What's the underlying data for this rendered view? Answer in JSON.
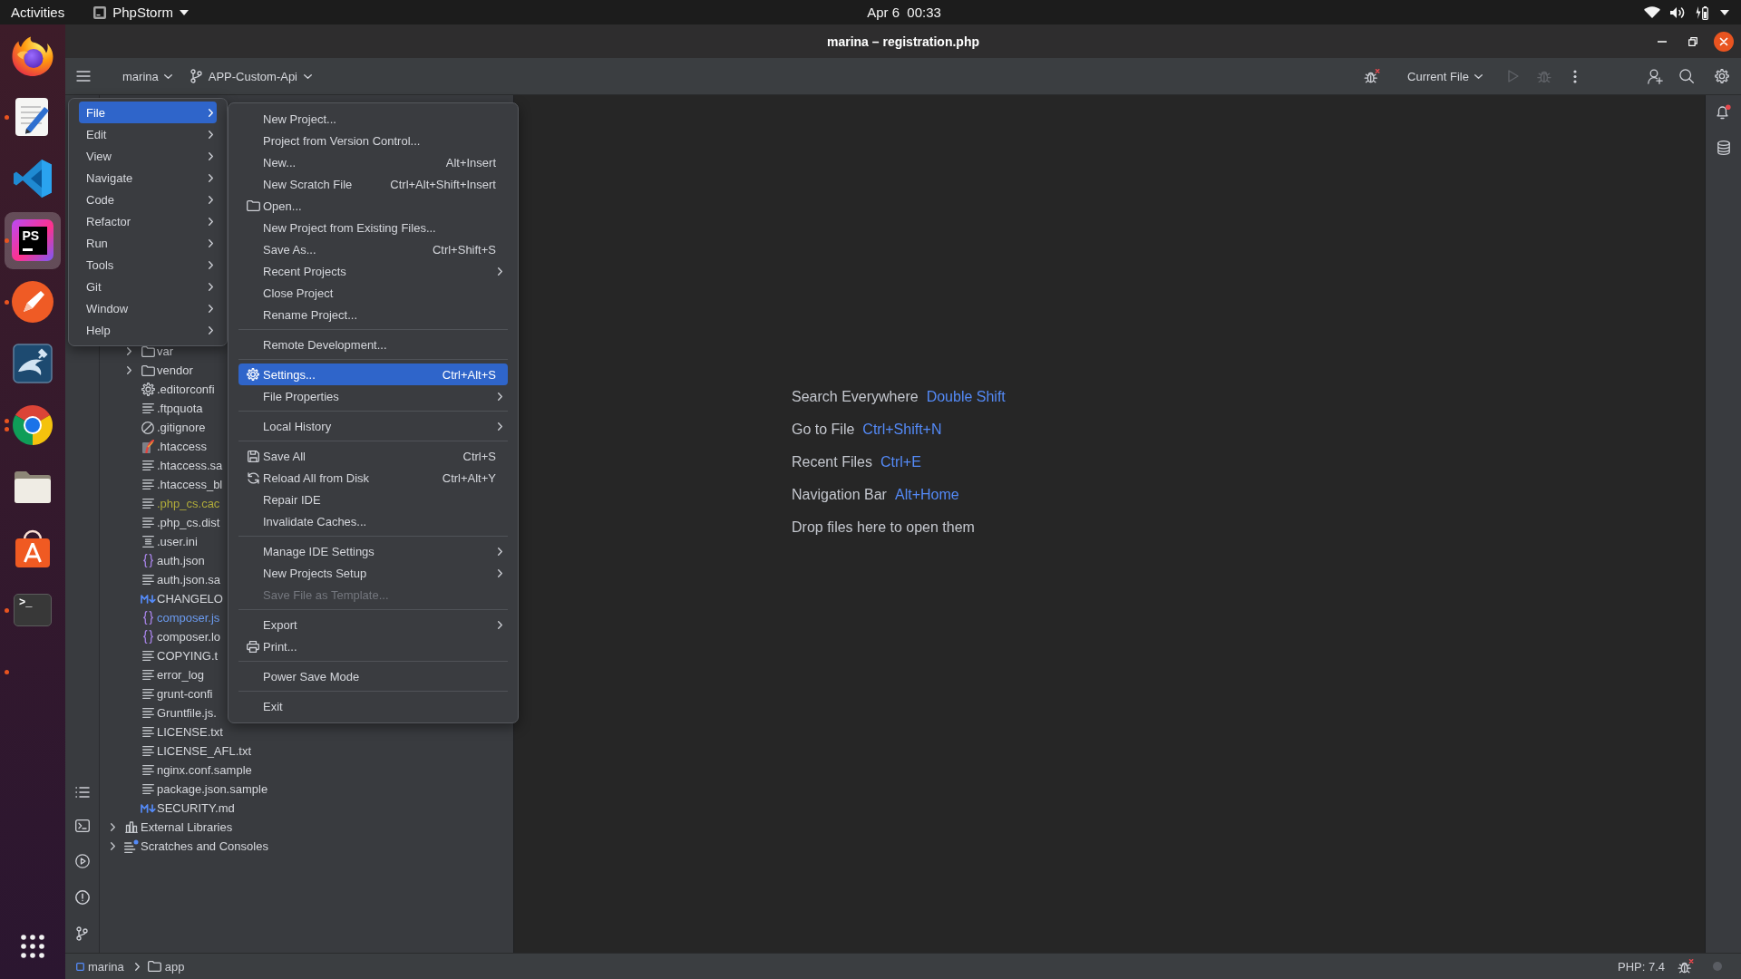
{
  "top_bar": {
    "activities": "Activities",
    "app_name": "PhpStorm",
    "clock": "Apr 6  00:33"
  },
  "dock": {
    "items": [
      {
        "kind": "fox-browser",
        "running": false,
        "multiple_windows": false,
        "selected": false
      },
      {
        "kind": "text-editor",
        "running": true,
        "multiple_windows": false,
        "selected": false
      },
      {
        "kind": "code-editor",
        "running": false,
        "multiple_windows": false,
        "selected": false
      },
      {
        "kind": "ide",
        "logo_text": "PS",
        "running": true,
        "multiple_windows": false,
        "selected": true
      },
      {
        "kind": "pen-circle",
        "running": true,
        "multiple_windows": false,
        "selected": false
      },
      {
        "kind": "dolphin",
        "running": false,
        "multiple_windows": false,
        "selected": false
      },
      {
        "kind": "wheel-browser",
        "running": true,
        "multiple_windows": true,
        "selected": false
      },
      {
        "kind": "files",
        "running": false,
        "multiple_windows": false,
        "selected": false
      },
      {
        "kind": "store-bag",
        "running": false,
        "multiple_windows": false,
        "selected": false
      },
      {
        "kind": "terminal",
        "logo_text": ">_",
        "running": true,
        "multiple_windows": false,
        "selected": false
      },
      {
        "kind": "none",
        "running": true,
        "multiple_windows": false,
        "selected": false
      }
    ]
  },
  "title_bar": {
    "title": "marina – registration.php"
  },
  "toolbar": {
    "project": "marina",
    "branch": "APP-Custom-Api",
    "run_configuration": "Current File"
  },
  "main_menu": {
    "items": [
      {
        "label": "File",
        "submenu": true,
        "selected": true
      },
      {
        "label": "Edit",
        "submenu": true,
        "selected": false
      },
      {
        "label": "View",
        "submenu": true,
        "selected": false
      },
      {
        "label": "Navigate",
        "submenu": true,
        "selected": false
      },
      {
        "label": "Code",
        "submenu": true,
        "selected": false
      },
      {
        "label": "Refactor",
        "submenu": true,
        "selected": false
      },
      {
        "label": "Run",
        "submenu": true,
        "selected": false
      },
      {
        "label": "Tools",
        "submenu": true,
        "selected": false
      },
      {
        "label": "Git",
        "submenu": true,
        "selected": false
      },
      {
        "label": "Window",
        "submenu": true,
        "selected": false
      },
      {
        "label": "Help",
        "submenu": true,
        "selected": false
      }
    ]
  },
  "file_menu": {
    "groups": [
      [
        {
          "label": "New Project...",
          "kind": "plain",
          "submenu": false,
          "disabled": false,
          "selected": false
        },
        {
          "label": "Project from Version Control...",
          "kind": "plain",
          "submenu": false,
          "disabled": false,
          "selected": false
        },
        {
          "label": "New...",
          "kind": "plain",
          "shortcut": "Alt+Insert",
          "submenu": false,
          "disabled": false,
          "selected": false
        },
        {
          "label": "New Scratch File",
          "kind": "plain",
          "shortcut": "Ctrl+Alt+Shift+Insert",
          "submenu": false,
          "disabled": false,
          "selected": false
        },
        {
          "label": "Open...",
          "kind": "open",
          "submenu": false,
          "disabled": false,
          "selected": false
        },
        {
          "label": "New Project from Existing Files...",
          "kind": "plain",
          "submenu": false,
          "disabled": false,
          "selected": false
        },
        {
          "label": "Save As...",
          "kind": "plain",
          "shortcut": "Ctrl+Shift+S",
          "submenu": false,
          "disabled": false,
          "selected": false
        },
        {
          "label": "Recent Projects",
          "kind": "plain",
          "submenu": true,
          "disabled": false,
          "selected": false
        },
        {
          "label": "Close Project",
          "kind": "plain",
          "submenu": false,
          "disabled": false,
          "selected": false
        },
        {
          "label": "Rename Project...",
          "kind": "plain",
          "submenu": false,
          "disabled": false,
          "selected": false
        }
      ],
      [
        {
          "label": "Remote Development...",
          "kind": "plain",
          "submenu": false,
          "disabled": false,
          "selected": false
        }
      ],
      [
        {
          "label": "Settings...",
          "kind": "settings",
          "shortcut": "Ctrl+Alt+S",
          "submenu": false,
          "disabled": false,
          "selected": true
        },
        {
          "label": "File Properties",
          "kind": "plain",
          "submenu": true,
          "disabled": false,
          "selected": false
        }
      ],
      [
        {
          "label": "Local History",
          "kind": "plain",
          "submenu": true,
          "disabled": false,
          "selected": false
        }
      ],
      [
        {
          "label": "Save All",
          "kind": "save",
          "shortcut": "Ctrl+S",
          "submenu": false,
          "disabled": false,
          "selected": false
        },
        {
          "label": "Reload All from Disk",
          "kind": "reload",
          "shortcut": "Ctrl+Alt+Y",
          "submenu": false,
          "disabled": false,
          "selected": false
        },
        {
          "label": "Repair IDE",
          "kind": "plain",
          "submenu": false,
          "disabled": false,
          "selected": false
        },
        {
          "label": "Invalidate Caches...",
          "kind": "plain",
          "submenu": false,
          "disabled": false,
          "selected": false
        }
      ],
      [
        {
          "label": "Manage IDE Settings",
          "kind": "plain",
          "submenu": true,
          "disabled": false,
          "selected": false
        },
        {
          "label": "New Projects Setup",
          "kind": "plain",
          "submenu": true,
          "disabled": false,
          "selected": false
        },
        {
          "label": "Save File as Template...",
          "kind": "plain",
          "submenu": false,
          "disabled": true,
          "selected": false
        }
      ],
      [
        {
          "label": "Export",
          "kind": "plain",
          "submenu": true,
          "disabled": false,
          "selected": false
        },
        {
          "label": "Print...",
          "kind": "print",
          "submenu": false,
          "disabled": false,
          "selected": false
        }
      ],
      [
        {
          "label": "Power Save Mode",
          "kind": "plain",
          "submenu": false,
          "disabled": false,
          "selected": false
        }
      ],
      [
        {
          "label": "Exit",
          "kind": "plain",
          "submenu": false,
          "disabled": false,
          "selected": false
        }
      ]
    ]
  },
  "project_tree": [
    {
      "children": [
        {
          "label": "var",
          "kind": "folder",
          "expanded": false,
          "ignored": false,
          "modified": false
        },
        {
          "label": "vendor",
          "kind": "folder",
          "expanded": false,
          "ignored": false,
          "modified": false
        },
        {
          "label": ".editorconfi",
          "kind": "config",
          "ignored": false,
          "modified": false
        },
        {
          "label": ".ftpquota",
          "kind": "text",
          "ignored": false,
          "modified": false
        },
        {
          "label": ".gitignore",
          "kind": "ignore",
          "ignored": false,
          "modified": false
        },
        {
          "label": ".htaccess",
          "kind": "htaccess",
          "ignored": false,
          "modified": false
        },
        {
          "label": ".htaccess.sa",
          "kind": "text",
          "ignored": false,
          "modified": false
        },
        {
          "label": ".htaccess_bl",
          "kind": "text",
          "ignored": false,
          "modified": false
        },
        {
          "label": ".php_cs.cac",
          "kind": "text",
          "ignored": true,
          "modified": false
        },
        {
          "label": ".php_cs.dist",
          "kind": "text",
          "ignored": false,
          "modified": false
        },
        {
          "label": ".user.ini",
          "kind": "ini",
          "ignored": false,
          "modified": false
        },
        {
          "label": "auth.json",
          "kind": "json",
          "ignored": false,
          "modified": false
        },
        {
          "label": "auth.json.sa",
          "kind": "text",
          "ignored": false,
          "modified": false
        },
        {
          "label": "CHANGELO",
          "kind": "markdown",
          "ignored": false,
          "modified": false
        },
        {
          "label": "composer.js",
          "kind": "json",
          "ignored": false,
          "modified": true
        },
        {
          "label": "composer.lo",
          "kind": "json",
          "ignored": false,
          "modified": false
        },
        {
          "label": "COPYING.t",
          "kind": "text",
          "ignored": false,
          "modified": false
        },
        {
          "label": "error_log",
          "kind": "text",
          "ignored": false,
          "modified": false
        },
        {
          "label": "grunt-confi",
          "kind": "text",
          "ignored": false,
          "modified": false
        },
        {
          "label": "Gruntfile.js.",
          "kind": "text",
          "ignored": false,
          "modified": false
        },
        {
          "label": "LICENSE.txt",
          "kind": "text",
          "ignored": false,
          "modified": false
        },
        {
          "label": "LICENSE_AFL.txt",
          "kind": "text",
          "ignored": false,
          "modified": false
        },
        {
          "label": "nginx.conf.sample",
          "kind": "text",
          "ignored": false,
          "modified": false
        },
        {
          "label": "package.json.sample",
          "kind": "text",
          "ignored": false,
          "modified": false
        },
        {
          "label": "SECURITY.md",
          "kind": "markdown",
          "ignored": false,
          "modified": false
        }
      ]
    },
    {
      "label": "External Libraries",
      "kind": "library",
      "expanded": false,
      "ignored": false,
      "modified": false
    },
    {
      "label": "Scratches and Consoles",
      "kind": "scratch",
      "expanded": false,
      "ignored": false,
      "modified": false
    }
  ],
  "editor_hints": {
    "actions": [
      {
        "label": "Search Everywhere",
        "shortcut": "Double Shift"
      },
      {
        "label": "Go to File",
        "shortcut": "Ctrl+Shift+N"
      },
      {
        "label": "Recent Files",
        "shortcut": "Ctrl+E"
      },
      {
        "label": "Navigation Bar",
        "shortcut": "Alt+Home"
      }
    ],
    "drop_hint": "Drop files here to open them"
  },
  "notifications": {
    "unread": true
  },
  "status_bar": {
    "breadcrumbs": [
      {
        "label": "marina",
        "kind": "project"
      },
      {
        "label": "app",
        "kind": "folder"
      }
    ],
    "php_version": "PHP: 7.4"
  }
}
